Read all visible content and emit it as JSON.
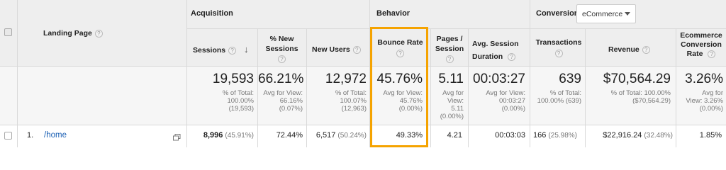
{
  "groups": {
    "acquisition": "Acquisition",
    "behavior": "Behavior",
    "conversions": "Conversions",
    "conversions_select": "eCommerce"
  },
  "columns": {
    "landing_page": "Landing Page",
    "sessions": "Sessions",
    "new_sessions": "% New Sessions",
    "new_users": "New Users",
    "bounce_rate": "Bounce Rate",
    "pages_session": "Pages / Session",
    "avg_session_duration": "Avg. Session Duration",
    "transactions": "Transactions",
    "revenue": "Revenue",
    "conversion_rate": "Ecommerce Conversion Rate"
  },
  "help_icon": "?",
  "sort_indicator": "↓",
  "totals": {
    "sessions": {
      "value": "19,593",
      "sub1": "% of Total:",
      "sub2": "100.00%",
      "sub3": "(19,593)"
    },
    "new_sessions": {
      "value": "66.21%",
      "sub1": "Avg for View:",
      "sub2": "66.16%",
      "sub3": "(0.07%)"
    },
    "new_users": {
      "value": "12,972",
      "sub1": "% of Total:",
      "sub2": "100.07%",
      "sub3": "(12,963)"
    },
    "bounce_rate": {
      "value": "45.76%",
      "sub1": "Avg for View:",
      "sub2": "45.76%",
      "sub3": "(0.00%)"
    },
    "pages_session": {
      "value": "5.11",
      "sub1": "Avg for",
      "sub2": "View:",
      "sub3": "5.11",
      "sub4": "(0.00%)"
    },
    "avg_session_duration": {
      "value": "00:03:27",
      "sub1": "Avg for View:",
      "sub2": "00:03:27",
      "sub3": "(0.00%)"
    },
    "transactions": {
      "value": "639",
      "sub1": "% of Total:",
      "sub2": "100.00% (639)"
    },
    "revenue": {
      "value": "$70,564.29",
      "sub1": "% of Total: 100.00%",
      "sub2": "($70,564.29)"
    },
    "conversion_rate": {
      "value": "3.26%",
      "sub1": "Avg for",
      "sub2": "View: 3.26%",
      "sub3": "(0.00%)"
    }
  },
  "rows": [
    {
      "index": "1.",
      "page": "/home",
      "sessions": "8,996",
      "sessions_pct": "(45.91%)",
      "new_sessions": "72.44%",
      "new_users": "6,517",
      "new_users_pct": "(50.24%)",
      "bounce_rate": "49.33%",
      "pages_session": "4.21",
      "avg_session_duration": "00:03:03",
      "transactions": "166",
      "transactions_pct": "(25.98%)",
      "revenue": "$22,916.24",
      "revenue_pct": "(32.48%)",
      "conversion_rate": "1.85%"
    }
  ],
  "highlight_color": "#f5a300"
}
